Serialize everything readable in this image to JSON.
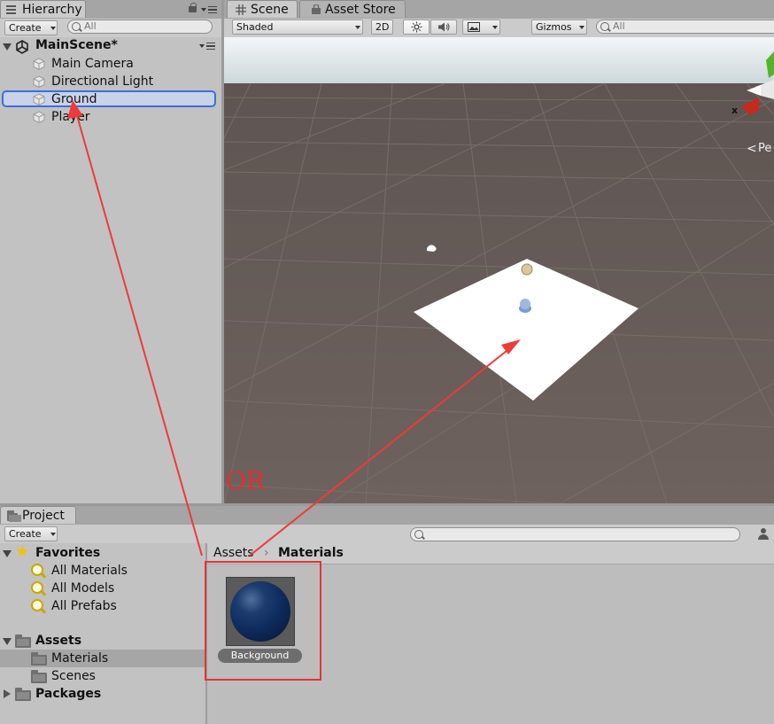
{
  "hierarchy": {
    "tab_label": "Hierarchy",
    "create_label": "Create",
    "search_placeholder": "All",
    "scene_name": "MainScene*",
    "items": [
      {
        "label": "Main Camera"
      },
      {
        "label": "Directional Light"
      },
      {
        "label": "Ground",
        "selected": true
      },
      {
        "label": "Player"
      }
    ]
  },
  "scene": {
    "tabs": [
      {
        "label": "Scene",
        "icon": "grid-icon"
      },
      {
        "label": "Asset Store",
        "icon": "bag-icon"
      }
    ],
    "shading_mode": "Shaded",
    "mode_2d": "2D",
    "gizmos_label": "Gizmos",
    "search_placeholder": "All",
    "axis_x_label": "x",
    "persp_label": "Pe",
    "colors": {
      "sky": "#dde6ea",
      "floor": "#6b5f5b",
      "plane": "#ffffff"
    }
  },
  "annotation": {
    "or_text": "OR",
    "color": "#ee3a3a"
  },
  "project": {
    "tab_label": "Project",
    "create_label": "Create",
    "favorites": {
      "label": "Favorites",
      "items": [
        "All Materials",
        "All Models",
        "All Prefabs"
      ]
    },
    "assets": {
      "label": "Assets",
      "children": [
        "Materials",
        "Scenes"
      ]
    },
    "packages_label": "Packages",
    "breadcrumb": [
      "Assets",
      "Materials"
    ],
    "asset_item": {
      "label": "Background",
      "color": "#0e2a5c"
    }
  }
}
